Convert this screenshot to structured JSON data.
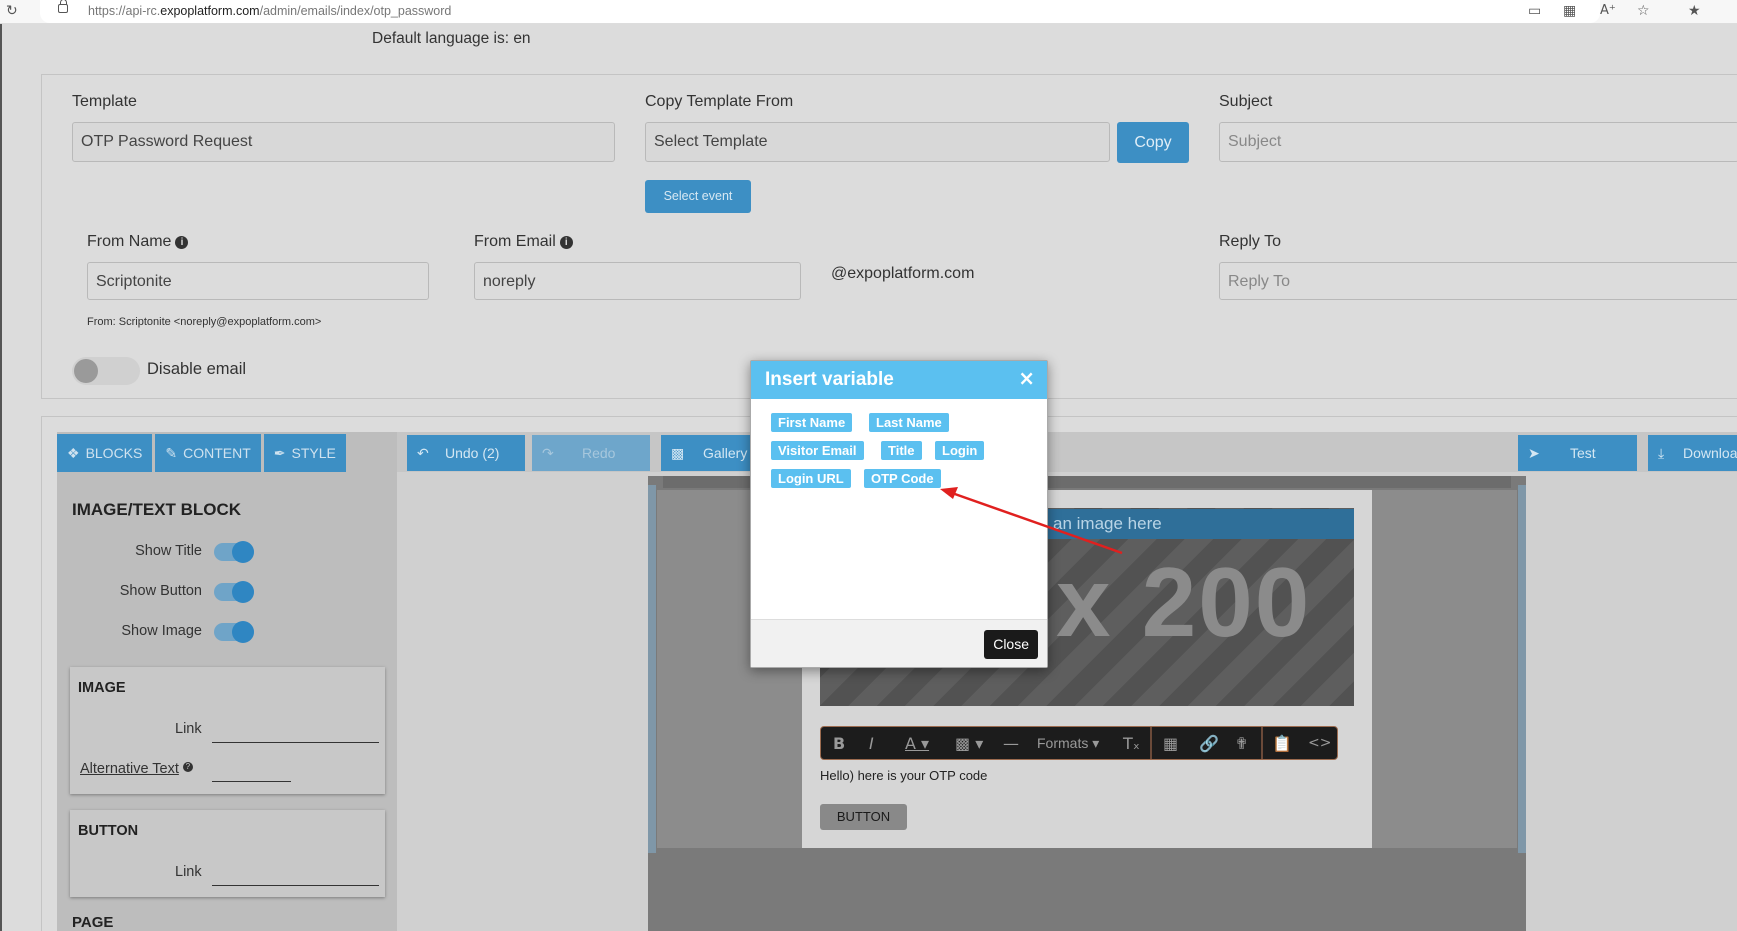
{
  "browser": {
    "url_prefix": "https://api-rc.",
    "url_domain": "expoplatform.com",
    "url_path": "/admin/emails/index/otp_password"
  },
  "page": {
    "default_language": "Default language is: en"
  },
  "form": {
    "template_label": "Template",
    "template_value": "OTP Password Request",
    "copy_from_label": "Copy Template From",
    "copy_from_value": "Select Template",
    "copy_button": "Copy",
    "select_event_button": "Select event",
    "subject_label": "Subject",
    "subject_placeholder": "Subject",
    "from_name_label": "From Name",
    "from_name_value": "Scriptonite",
    "from_email_label": "From Email",
    "from_email_value": "noreply",
    "email_domain": "@expoplatform.com",
    "reply_to_label": "Reply To",
    "reply_to_placeholder": "Reply To",
    "from_preview": "From: Scriptonite <noreply@expoplatform.com>",
    "disable_email_label": "Disable email"
  },
  "sidebar": {
    "tabs": [
      "BLOCKS",
      "CONTENT",
      "STYLE"
    ],
    "block_title": "IMAGE/TEXT BLOCK",
    "options": [
      "Show Title",
      "Show Button",
      "Show Image"
    ],
    "image_card": {
      "heading": "IMAGE",
      "link_label": "Link",
      "alt_text_label": "Alternative Text"
    },
    "button_card": {
      "heading": "BUTTON",
      "link_label": "Link"
    },
    "page_heading": "PAGE"
  },
  "editor": {
    "undo": "Undo (2)",
    "redo": "Redo",
    "gallery": "Gallery",
    "test": "Test",
    "download": "Download",
    "image_label": "an image here",
    "image_dims": "x 200",
    "formats": "Formats",
    "body_text": "Hello) here is your OTP code",
    "email_button": "BUTTON"
  },
  "modal": {
    "title": "Insert variable",
    "variables": [
      "First Name",
      "Last Name",
      "Visitor Email",
      "Title",
      "Login",
      "Login URL",
      "OTP Code"
    ],
    "close_button": "Close"
  },
  "colors": {
    "accent": "#3d8fc4",
    "modal_header": "#5bc0f0",
    "annotation_arrow": "#e0201f"
  }
}
